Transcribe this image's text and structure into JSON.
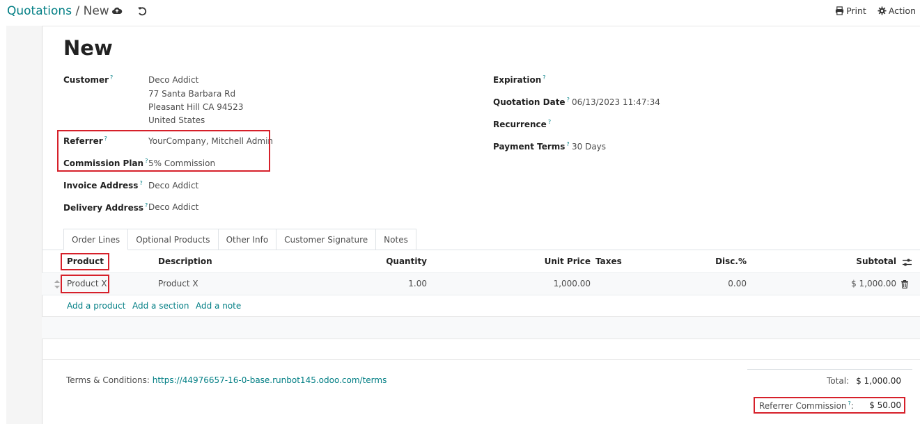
{
  "breadcrumb": {
    "parent": "Quotations",
    "separator": "/",
    "current": "New"
  },
  "toolbar": {
    "print_label": "Print",
    "action_label": "Action"
  },
  "record": {
    "title": "New"
  },
  "fields": {
    "customer": {
      "label": "Customer",
      "help": "?",
      "name": "Deco Addict",
      "street": "77 Santa Barbara Rd",
      "city": "Pleasant Hill CA 94523",
      "country": "United States"
    },
    "referrer": {
      "label": "Referrer",
      "help": "?",
      "value": "YourCompany, Mitchell Admin"
    },
    "commission_plan": {
      "label": "Commission Plan",
      "help": "?",
      "value": "5% Commission"
    },
    "invoice_address": {
      "label": "Invoice Address",
      "help": "?",
      "value": "Deco Addict"
    },
    "delivery_address": {
      "label": "Delivery Address",
      "help": "?",
      "value": "Deco Addict"
    },
    "expiration": {
      "label": "Expiration",
      "help": "?",
      "value": ""
    },
    "quotation_date": {
      "label": "Quotation Date",
      "help": "?",
      "value": "06/13/2023 11:47:34"
    },
    "recurrence": {
      "label": "Recurrence",
      "help": "?",
      "value": ""
    },
    "payment_terms": {
      "label": "Payment Terms",
      "help": "?",
      "value": "30 Days"
    }
  },
  "tabs": [
    "Order Lines",
    "Optional Products",
    "Other Info",
    "Customer Signature",
    "Notes"
  ],
  "order_lines": {
    "columns": {
      "product": "Product",
      "description": "Description",
      "quantity": "Quantity",
      "unit_price": "Unit Price",
      "taxes": "Taxes",
      "discount": "Disc.%",
      "subtotal": "Subtotal"
    },
    "rows": [
      {
        "product": "Product X",
        "description": "Product X",
        "quantity": "1.00",
        "unit_price": "1,000.00",
        "taxes": "",
        "discount": "0.00",
        "subtotal": "$ 1,000.00"
      }
    ],
    "add_product": "Add a product",
    "add_section": "Add a section",
    "add_note": "Add a note"
  },
  "terms": {
    "label": "Terms & Conditions:",
    "url": "https://44976657-16-0-base.runbot145.odoo.com/terms"
  },
  "totals": {
    "total_label": "Total:",
    "total_value": "$ 1,000.00",
    "commission_label": "Referrer Commission",
    "commission_help": "?",
    "commission_colon": ":",
    "commission_value": "$ 50.00"
  },
  "colors": {
    "accent": "#017e84",
    "highlight": "#d6202a"
  }
}
